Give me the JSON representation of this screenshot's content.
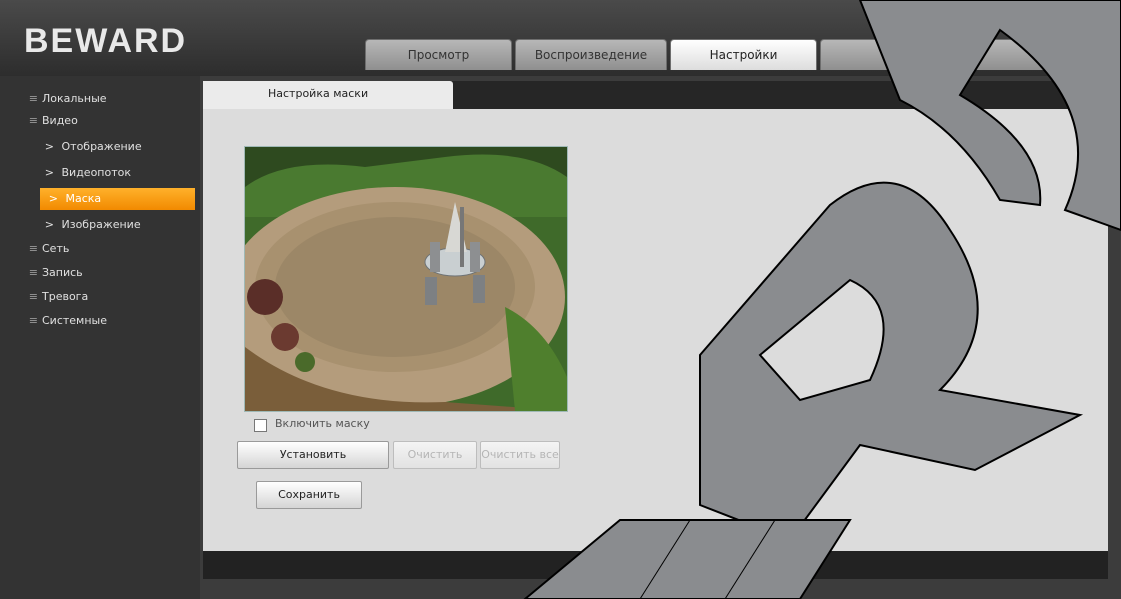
{
  "header": {
    "logo_text": "BEWARD"
  },
  "tabs": [
    {
      "label": "Просмотр",
      "active": false
    },
    {
      "label": "Воспроизведение",
      "active": false
    },
    {
      "label": "Настройки",
      "active": true
    },
    {
      "label": "",
      "active": false
    },
    {
      "label": "",
      "active": false
    }
  ],
  "sidebar": {
    "items": [
      {
        "label": "Локальные",
        "bullet": "≡"
      },
      {
        "label": "Видео",
        "bullet": "≡"
      },
      {
        "label": "Отображение",
        "bullet": ">"
      },
      {
        "label": "Видеопоток",
        "bullet": ">"
      },
      {
        "label": "Маска",
        "bullet": ">"
      },
      {
        "label": "Изображение",
        "bullet": ">"
      },
      {
        "label": "Сеть",
        "bullet": "≡"
      },
      {
        "label": "Запись",
        "bullet": "≡"
      },
      {
        "label": "Тревога",
        "bullet": "≡"
      },
      {
        "label": "Системные",
        "bullet": "≡"
      }
    ]
  },
  "content": {
    "subtab_label": "Настройка маски",
    "video_alt": "camera-preview-patio",
    "checkbox_label": "Включить маску",
    "checkbox_checked": false,
    "buttons": {
      "set": "Установить",
      "clear": "Очистить",
      "clear_all": "Очистить все",
      "save": "Сохранить"
    }
  },
  "colors": {
    "accent": "#f28a00",
    "background": "#3c3c3c",
    "panel": "#dcdcdc",
    "watermark": "#8a8c8f"
  },
  "watermark_text": "BEWARD"
}
